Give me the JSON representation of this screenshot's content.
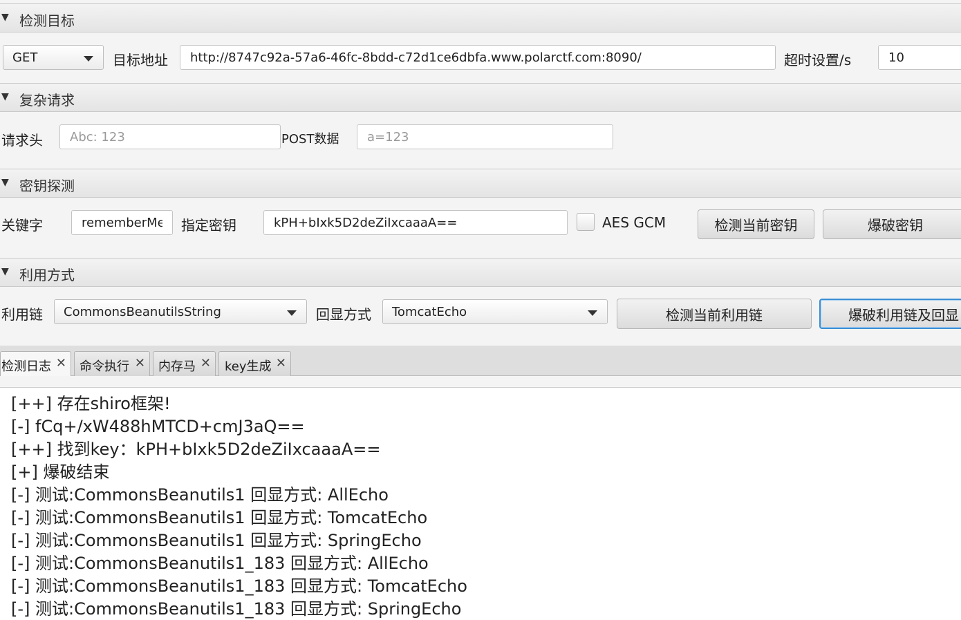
{
  "sections": {
    "target": "检测目标",
    "complex": "复杂请求",
    "key": "密钥探测",
    "exploit": "利用方式"
  },
  "target": {
    "method": "GET",
    "url_label": "目标地址",
    "url": "http://8747c92a-57a6-46fc-8bdd-c72d1ce6dbfa.www.polarctf.com:8090/",
    "timeout_label": "超时设置/s",
    "timeout": "10"
  },
  "complex": {
    "header_label": "请求头",
    "header_placeholder": "Abc: 123",
    "post_label": "POST数据",
    "post_placeholder": "a=123"
  },
  "keydetect": {
    "keyword_label": "关键字",
    "keyword": "rememberMe",
    "key_label": "指定密钥",
    "key": "kPH+bIxk5D2deZiIxcaaaA==",
    "aes_gcm": "AES GCM",
    "detect_btn": "检测当前密钥",
    "brute_btn": "爆破密钥"
  },
  "exploit": {
    "chain_label": "利用链",
    "chain": "CommonsBeanutilsString",
    "echo_label": "回显方式",
    "echo": "TomcatEcho",
    "detect_btn": "检测当前利用链",
    "brute_btn": "爆破利用链及回显"
  },
  "tabs": [
    {
      "label": "检测日志",
      "close": "✕"
    },
    {
      "label": "命令执行",
      "close": "✕"
    },
    {
      "label": "内存马",
      "close": "✕"
    },
    {
      "label": "key生成",
      "close": "✕"
    }
  ],
  "log": [
    "[++] 存在shiro框架!",
    "[-] fCq+/xW488hMTCD+cmJ3aQ==",
    "[++] 找到key：kPH+bIxk5D2deZiIxcaaaA==",
    "[+] 爆破结束",
    "[-] 测试:CommonsBeanutils1  回显方式: AllEcho",
    "[-] 测试:CommonsBeanutils1  回显方式: TomcatEcho",
    "[-] 测试:CommonsBeanutils1  回显方式: SpringEcho",
    "[-] 测试:CommonsBeanutils1_183  回显方式: AllEcho",
    "[-] 测试:CommonsBeanutils1_183  回显方式: TomcatEcho",
    "[-] 测试:CommonsBeanutils1_183  回显方式: SpringEcho"
  ]
}
